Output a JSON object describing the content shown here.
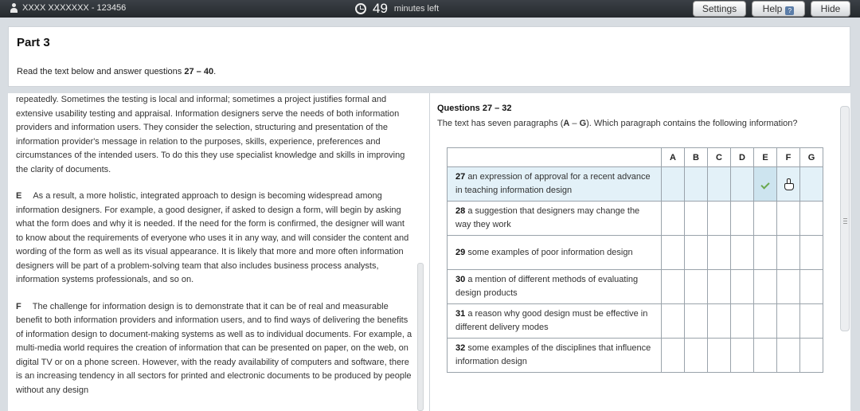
{
  "topbar": {
    "candidate": "XXXX XXXXXXX - 123456",
    "minutes": "49",
    "minutes_label": "minutes left",
    "settings": "Settings",
    "help": "Help",
    "help_icon_glyph": "?",
    "hide": "Hide"
  },
  "header": {
    "title": "Part 3",
    "instruction_pre": "Read the text below and answer questions ",
    "instruction_range": "27 – 40",
    "instruction_post": "."
  },
  "passage": {
    "p_top": "repeatedly. Sometimes the testing is local and informal; sometimes a project justifies formal and extensive usability testing and appraisal. Information designers serve the needs of both information providers and information users. They consider the selection, structuring and presentation of the information provider's message in relation to the purposes, skills, experience, preferences and circumstances of the intended users. To do this they use specialist knowledge and skills in improving the clarity of documents.",
    "p_e_letter": "E",
    "p_e": "As a result, a more holistic, integrated approach to design is becoming widespread among information designers. For example, a good designer, if asked to design a form, will begin by asking what the form does and why it is needed. If the need for the form is confirmed, the designer will want to know about the requirements of everyone who uses it in any way, and will consider the content and wording of the form as well as its visual appearance. It is likely that more and more often information designers will be part of a problem-solving team that also includes business process analysts, information systems professionals, and so on.",
    "p_f_letter": "F",
    "p_f": "The challenge for information design is to demonstrate that it can be of real and measurable benefit to both information providers and information users, and to find ways of delivering the benefits of information design to document-making systems as well as to individual documents. For example, a multi-media world requires the creation of information that can be presented on paper, on the web, on digital TV or on a phone screen. However, with the ready availability of computers and software, there is an increasing tendency in all sectors for printed and electronic documents to be produced by people without any design"
  },
  "questions": {
    "heading": "Questions 27 – 32",
    "prompt_pre": "The text has seven paragraphs (",
    "prompt_a": "A",
    "prompt_dash": " – ",
    "prompt_g": "G",
    "prompt_post": "). Which paragraph contains the following information?",
    "columns": [
      "A",
      "B",
      "C",
      "D",
      "E",
      "F",
      "G"
    ],
    "rows": [
      {
        "num": "27",
        "text": "an expression of approval for a recent advance in teaching information design"
      },
      {
        "num": "28",
        "text": "a suggestion that designers may change the way they work"
      },
      {
        "num": "29",
        "text": "some examples of poor information design"
      },
      {
        "num": "30",
        "text": "a mention of different methods of evaluating design products"
      },
      {
        "num": "31",
        "text": "a reason why good design must be effective in different delivery modes"
      },
      {
        "num": "32",
        "text": "some examples of the disciplines that influence information design"
      }
    ],
    "selected": {
      "row": 0,
      "column": "E"
    }
  }
}
